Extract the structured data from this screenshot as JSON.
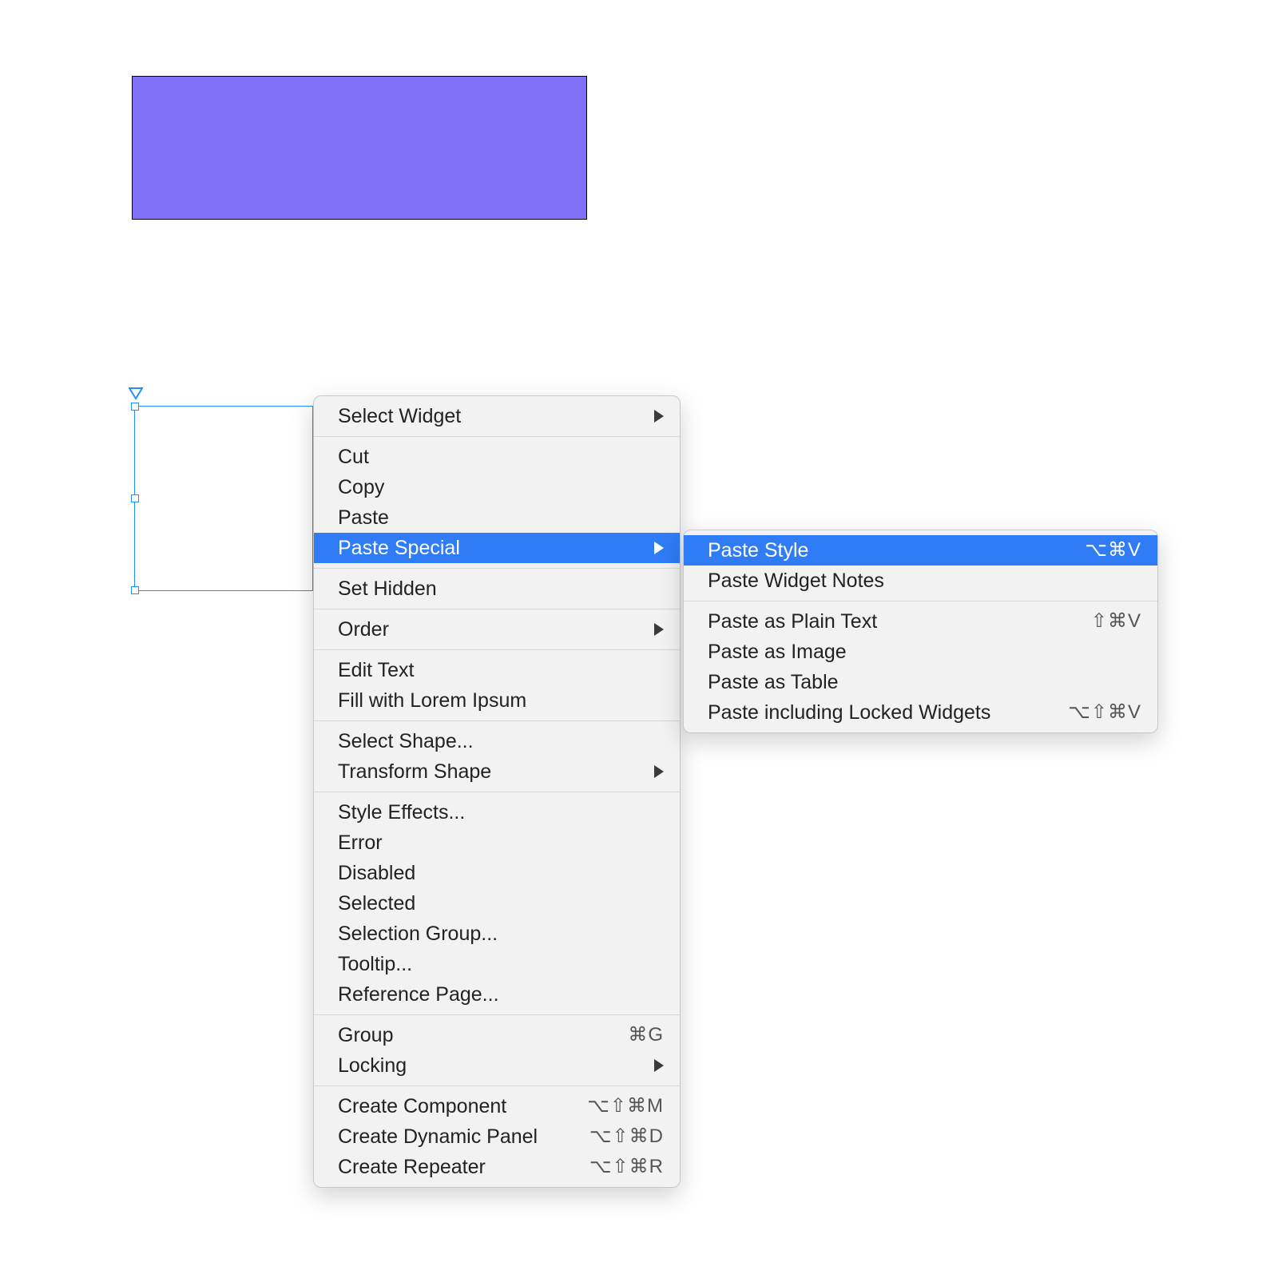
{
  "canvas": {
    "purple_rect_color": "#7f70f5"
  },
  "menu": {
    "items": [
      {
        "label": "Select Widget",
        "submenu": true
      },
      {
        "sep": true
      },
      {
        "label": "Cut"
      },
      {
        "label": "Copy"
      },
      {
        "label": "Paste"
      },
      {
        "label": "Paste Special",
        "submenu": true,
        "highlight": true
      },
      {
        "sep": true
      },
      {
        "label": "Set Hidden"
      },
      {
        "sep": true
      },
      {
        "label": "Order",
        "submenu": true
      },
      {
        "sep": true
      },
      {
        "label": "Edit Text"
      },
      {
        "label": "Fill with Lorem Ipsum"
      },
      {
        "sep": true
      },
      {
        "label": "Select Shape..."
      },
      {
        "label": "Transform Shape",
        "submenu": true
      },
      {
        "sep": true
      },
      {
        "label": "Style Effects..."
      },
      {
        "label": "Error"
      },
      {
        "label": "Disabled"
      },
      {
        "label": "Selected"
      },
      {
        "label": "Selection Group..."
      },
      {
        "label": "Tooltip..."
      },
      {
        "label": "Reference Page..."
      },
      {
        "sep": true
      },
      {
        "label": "Group",
        "shortcut": "⌘G"
      },
      {
        "label": "Locking",
        "submenu": true
      },
      {
        "sep": true
      },
      {
        "label": "Create Component",
        "shortcut": "⌥⇧⌘M"
      },
      {
        "label": "Create Dynamic Panel",
        "shortcut": "⌥⇧⌘D"
      },
      {
        "label": "Create Repeater",
        "shortcut": "⌥⇧⌘R"
      }
    ]
  },
  "submenu": {
    "items": [
      {
        "label": "Paste Style",
        "shortcut": "⌥⌘V",
        "highlight": true
      },
      {
        "label": "Paste Widget Notes"
      },
      {
        "sep": true
      },
      {
        "label": "Paste as Plain Text",
        "shortcut": "⇧⌘V"
      },
      {
        "label": "Paste as Image"
      },
      {
        "label": "Paste as Table"
      },
      {
        "label": "Paste including Locked Widgets",
        "shortcut": "⌥⇧⌘V"
      }
    ]
  }
}
